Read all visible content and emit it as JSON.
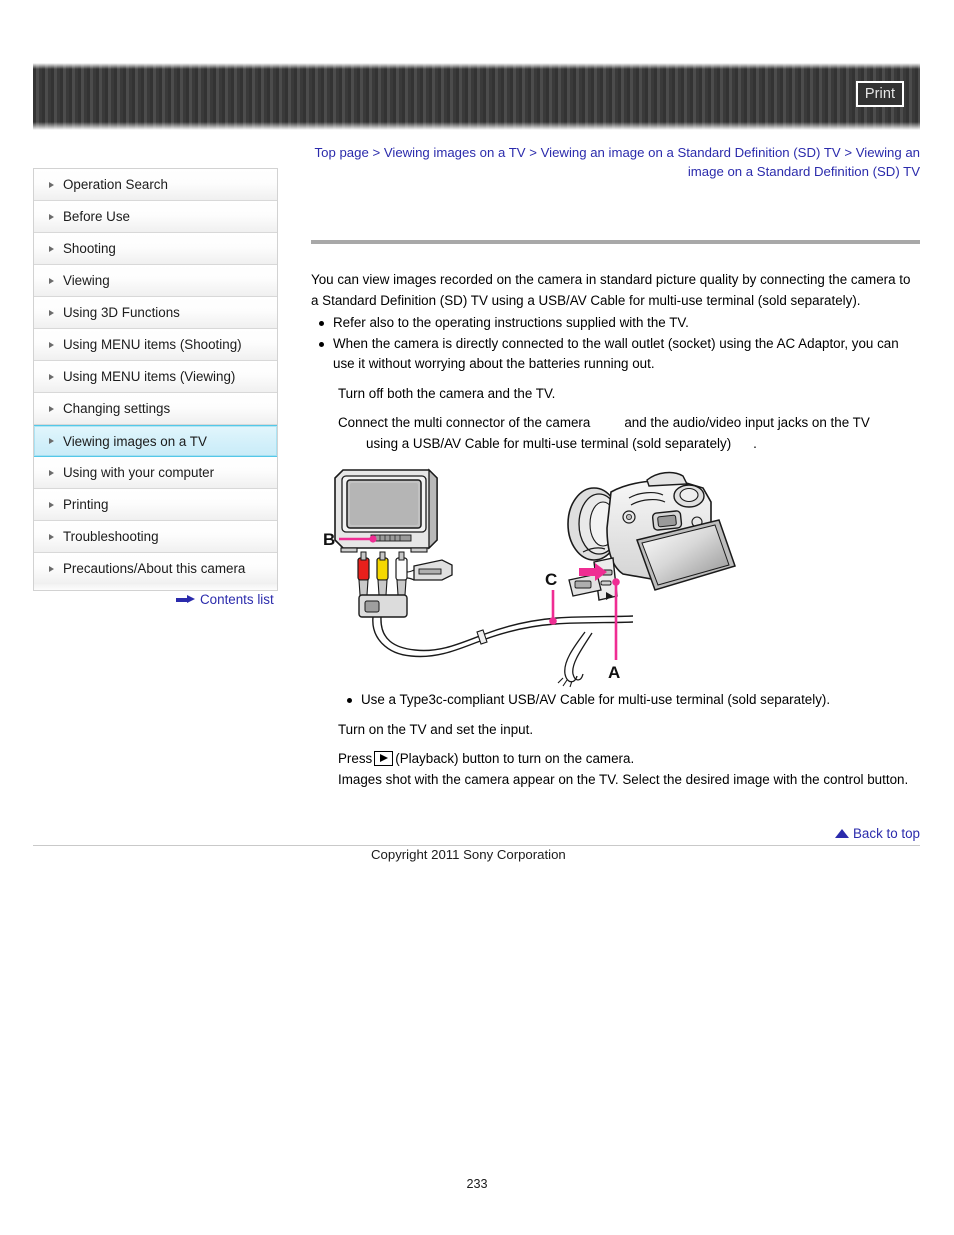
{
  "header": {
    "print_label": "Print"
  },
  "breadcrumb": {
    "items": [
      "Top page",
      "Viewing images on a TV",
      "Viewing an image on a Standard Definition (SD) TV",
      "Viewing an image on a Standard Definition (SD) TV"
    ],
    "separator": ">"
  },
  "sidebar": {
    "items": [
      {
        "label": "Operation Search",
        "active": false
      },
      {
        "label": "Before Use",
        "active": false
      },
      {
        "label": "Shooting",
        "active": false
      },
      {
        "label": "Viewing",
        "active": false
      },
      {
        "label": "Using 3D Functions",
        "active": false
      },
      {
        "label": "Using MENU items (Shooting)",
        "active": false
      },
      {
        "label": "Using MENU items (Viewing)",
        "active": false
      },
      {
        "label": "Changing settings",
        "active": false
      },
      {
        "label": "Viewing images on a TV",
        "active": true
      },
      {
        "label": "Using with your computer",
        "active": false
      },
      {
        "label": "Printing",
        "active": false
      },
      {
        "label": "Troubleshooting",
        "active": false
      },
      {
        "label": "Precautions/About this camera",
        "active": false
      }
    ],
    "contents_list_label": "Contents list"
  },
  "main": {
    "intro": "You can view images recorded on the camera in standard picture quality by connecting the camera to a Standard Definition (SD) TV using a USB/AV Cable for multi-use terminal (sold separately).",
    "notes": [
      "Refer also to the operating instructions supplied with the TV.",
      "When the camera is directly connected to the wall outlet (socket) using the AC Adaptor, you can use it without worrying about the batteries running out."
    ],
    "step1": "Turn off both the camera and the TV.",
    "step2_part1": "Connect the multi connector of the camera",
    "step2_part2": "and the audio/video input jacks on the TV",
    "step2_part3": "using a USB/AV Cable for multi-use terminal (sold separately)",
    "step2_part4": ".",
    "cable_note": "Use a Type3c-compliant USB/AV Cable for multi-use terminal (sold separately).",
    "step3": "Turn on the TV and set the input.",
    "step4_pre": "Press",
    "step4_post": "(Playback) button to turn on the camera.",
    "step4_detail": "Images shot with the camera appear on the TV. Select the desired image with the control button.",
    "diagram": {
      "callout_a": "A",
      "callout_b": "B",
      "callout_c": "C"
    }
  },
  "footer": {
    "back_to_top_label": "Back to top",
    "copyright": "Copyright 2011 Sony Corporation",
    "page_number": "233"
  },
  "colors": {
    "link": "#2b2bac",
    "callout": "#ef2d93",
    "active_nav_border": "#54c8e8"
  }
}
